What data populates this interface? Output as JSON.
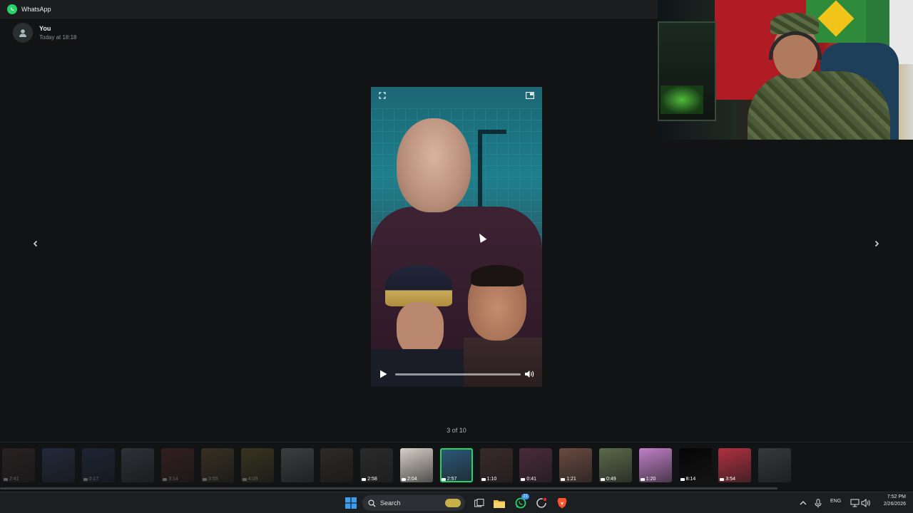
{
  "app": {
    "title": "WhatsApp"
  },
  "sender": {
    "name": "You",
    "timestamp": "Today at 18:18"
  },
  "viewer": {
    "counter": "3 of 10",
    "progress": 0.0
  },
  "thumbnails": [
    {
      "duration": "2:41",
      "dim": true,
      "color": "#5a4040"
    },
    {
      "duration": "",
      "dim": true,
      "color": "#4a5a90"
    },
    {
      "duration": "0:17",
      "dim": true,
      "color": "#3a4a7a"
    },
    {
      "duration": "",
      "dim": true,
      "color": "#6a7080"
    },
    {
      "duration": "3:14",
      "dim": true,
      "color": "#7a3a3a"
    },
    {
      "duration": "3:55",
      "dim": true,
      "color": "#8a6a40"
    },
    {
      "duration": "4:09",
      "dim": true,
      "color": "#8a7a3a"
    },
    {
      "duration": "",
      "dim": true,
      "color": "#9a9a9a"
    },
    {
      "duration": "",
      "dim": true,
      "color": "#6a5a50"
    },
    {
      "duration": "2:58",
      "dim": false,
      "color": "#2a2a2a"
    },
    {
      "duration": "2:04",
      "dim": false,
      "color": "#d8d0c8"
    },
    {
      "duration": "2:57",
      "dim": false,
      "selected": true,
      "color": "#2c5a7a"
    },
    {
      "duration": "1:10",
      "dim": false,
      "color": "#3a2a2a"
    },
    {
      "duration": "0:41",
      "dim": false,
      "color": "#4a2a3a"
    },
    {
      "duration": "1:21",
      "dim": false,
      "color": "#6a4a40"
    },
    {
      "duration": "0:49",
      "dim": false,
      "color": "#5a6a4a"
    },
    {
      "duration": "1:20",
      "dim": false,
      "color": "#c080c8"
    },
    {
      "duration": "8:14",
      "dim": false,
      "color": "#050505"
    },
    {
      "duration": "3:54",
      "dim": false,
      "color": "#b03040"
    },
    {
      "duration": "",
      "dim": true,
      "color": "#8a8a8a"
    }
  ],
  "taskbar": {
    "search_label": "Search",
    "whatsapp_badge": "21",
    "language": "ENG",
    "time": "7:52 PM",
    "date": "2/26/2026"
  }
}
